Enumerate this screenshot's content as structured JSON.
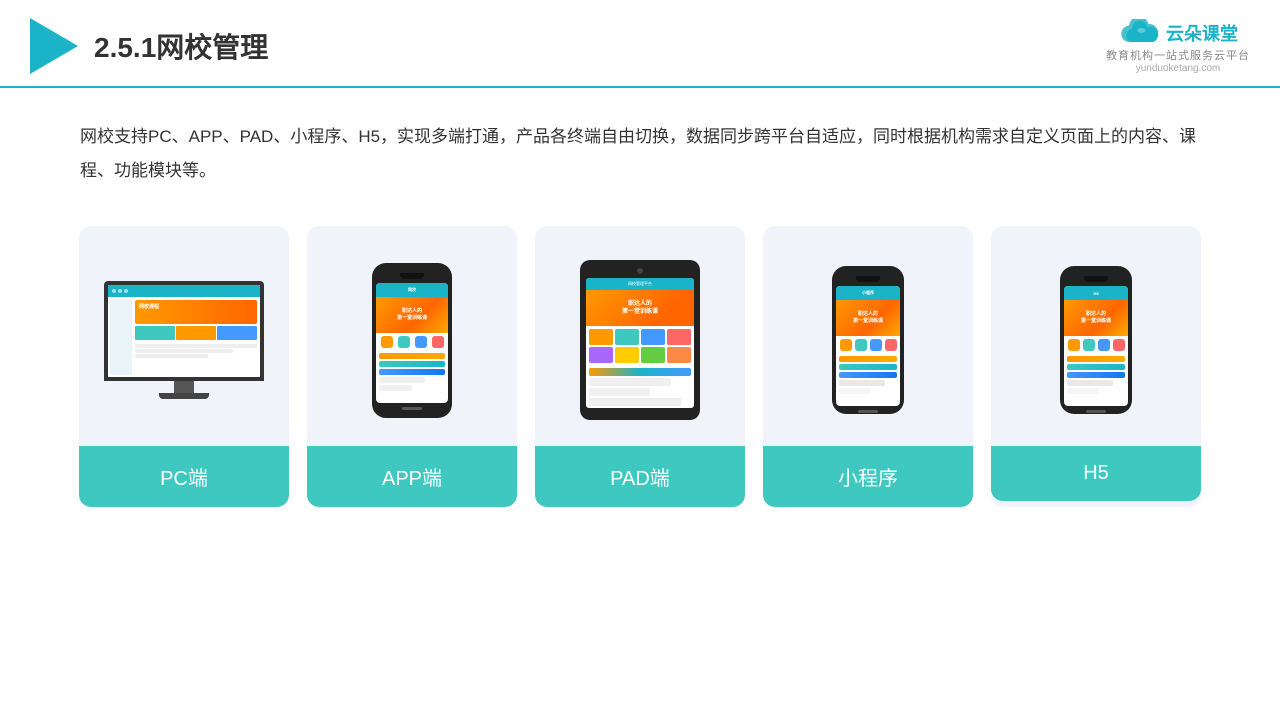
{
  "header": {
    "title": "2.5.1网校管理",
    "brand_name": "云朵课堂",
    "brand_tagline": "教育机构一站\n式服务云平台",
    "brand_url": "yunduoketang.com"
  },
  "description": {
    "text": "网校支持PC、APP、PAD、小程序、H5，实现多端打通，产品各终端自由切换，数据同步跨平台自适应，同时根据机构需求自定义页面上的内容、课程、功能模块等。"
  },
  "cards": [
    {
      "id": "pc",
      "label": "PC端"
    },
    {
      "id": "app",
      "label": "APP端"
    },
    {
      "id": "pad",
      "label": "PAD端"
    },
    {
      "id": "mini",
      "label": "小程序"
    },
    {
      "id": "h5",
      "label": "H5"
    }
  ],
  "colors": {
    "accent": "#1ab3c8",
    "card_bg": "#eef2fa",
    "label_bg": "#3ec8c0"
  }
}
